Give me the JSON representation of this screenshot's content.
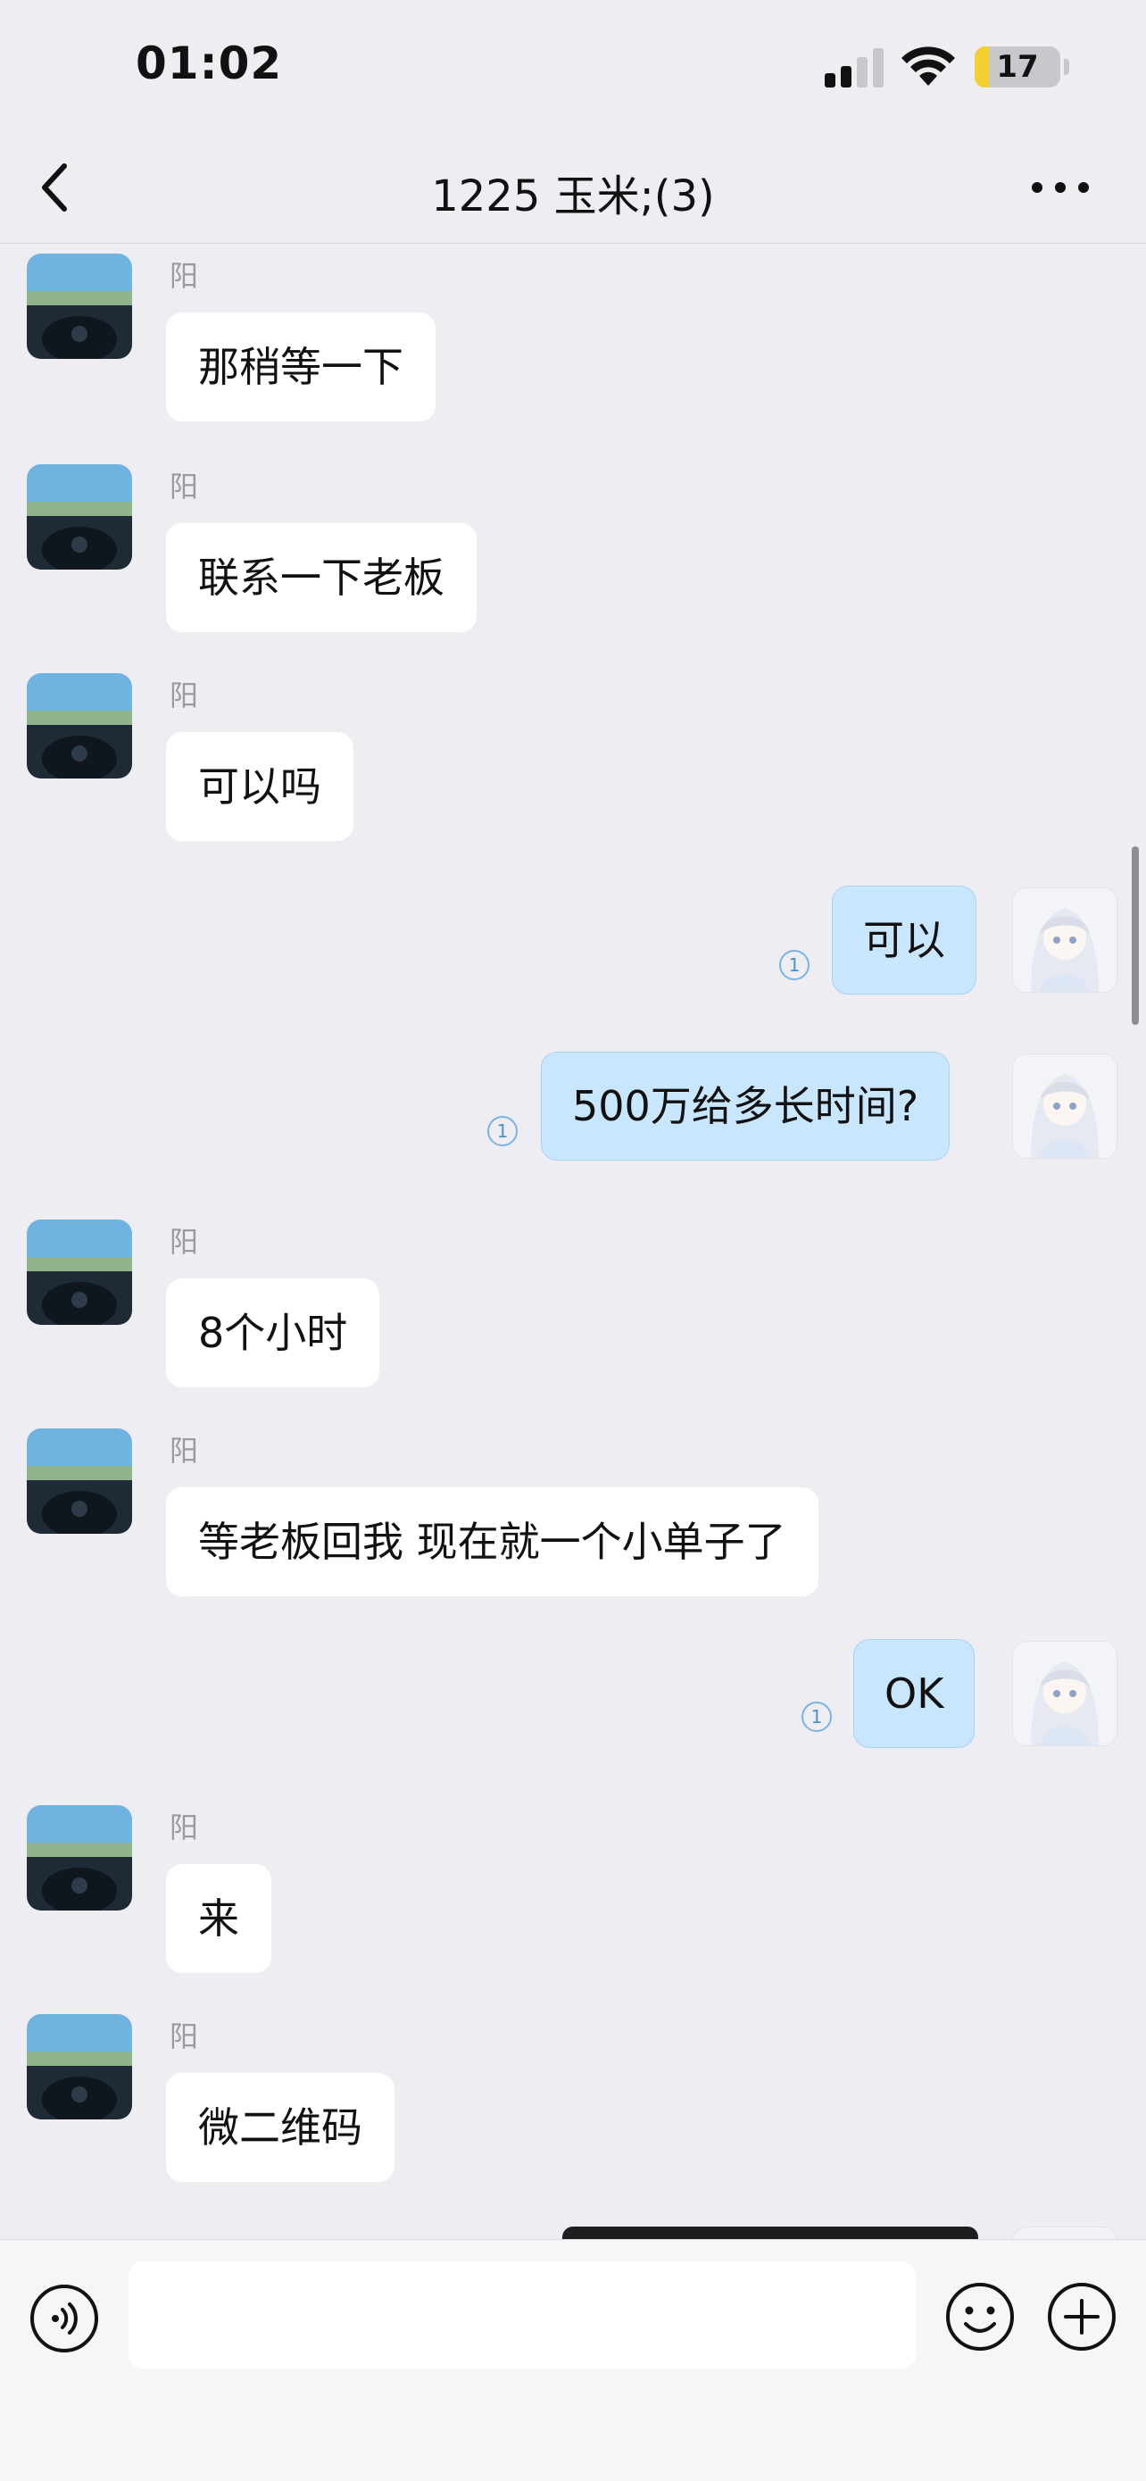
{
  "status_bar": {
    "time": "01:02",
    "battery_level": "17",
    "battery_fraction": 0.17
  },
  "nav": {
    "title": "1225 玉米;(3)"
  },
  "messages": [
    {
      "side": "left",
      "sender": "阳",
      "text": "那稍等一下"
    },
    {
      "side": "left",
      "sender": "阳",
      "text": "联系一下老板"
    },
    {
      "side": "left",
      "sender": "阳",
      "text": "可以吗"
    },
    {
      "side": "right",
      "text": "可以",
      "read_count": "1"
    },
    {
      "side": "right",
      "text": "500万给多长时间?",
      "read_count": "1"
    },
    {
      "side": "left",
      "sender": "阳",
      "text": "8个小时"
    },
    {
      "side": "left",
      "sender": "阳",
      "text": "等老板回我 现在就一个小单子了"
    },
    {
      "side": "right",
      "text": "OK",
      "read_count": "1"
    },
    {
      "side": "left",
      "sender": "阳",
      "text": "来"
    },
    {
      "side": "left",
      "sender": "阳",
      "text": "微二维码"
    }
  ],
  "input": {
    "placeholder": "",
    "value": ""
  },
  "icons": {
    "back": "chevron-left-icon",
    "more": "more-horizontal-icon",
    "voice": "voice-icon",
    "emoji": "emoji-icon",
    "plus": "plus-icon"
  },
  "colors": {
    "background": "#EDEDF2",
    "self_bubble": "#C9E6FF",
    "other_bubble": "#FFFFFF",
    "battery": "#F5CF2E"
  }
}
